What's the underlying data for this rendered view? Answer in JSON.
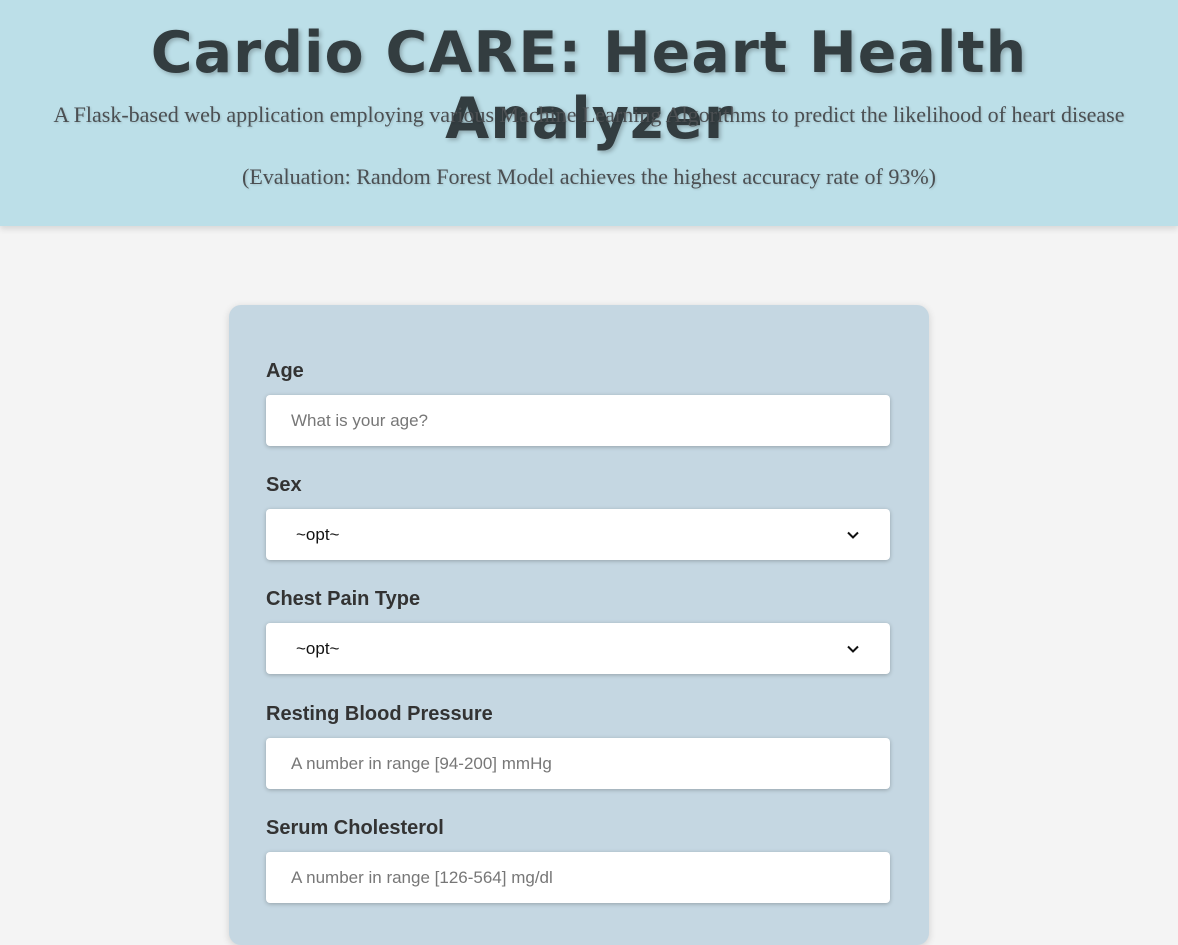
{
  "header": {
    "title": "Cardio CARE: Heart Health Analyzer",
    "subtitle": "A Flask-based web application employing various Machine Learning Algorithms to predict the likelihood of heart disease",
    "evaluation": "(Evaluation: Random Forest Model achieves the highest accuracy rate of 93%)"
  },
  "form": {
    "age": {
      "label": "Age",
      "placeholder": "What is your age?"
    },
    "sex": {
      "label": "Sex",
      "selected": "~opt~"
    },
    "chest_pain": {
      "label": "Chest Pain Type",
      "selected": "~opt~"
    },
    "resting_bp": {
      "label": "Resting Blood Pressure",
      "placeholder": "A number in range [94-200] mmHg"
    },
    "cholesterol": {
      "label": "Serum Cholesterol",
      "placeholder": "A number in range [126-564] mg/dl"
    }
  },
  "colors": {
    "header_bg": "#bcdfe8",
    "card_bg": "#c5d7e2",
    "page_bg": "#f4f4f4"
  }
}
